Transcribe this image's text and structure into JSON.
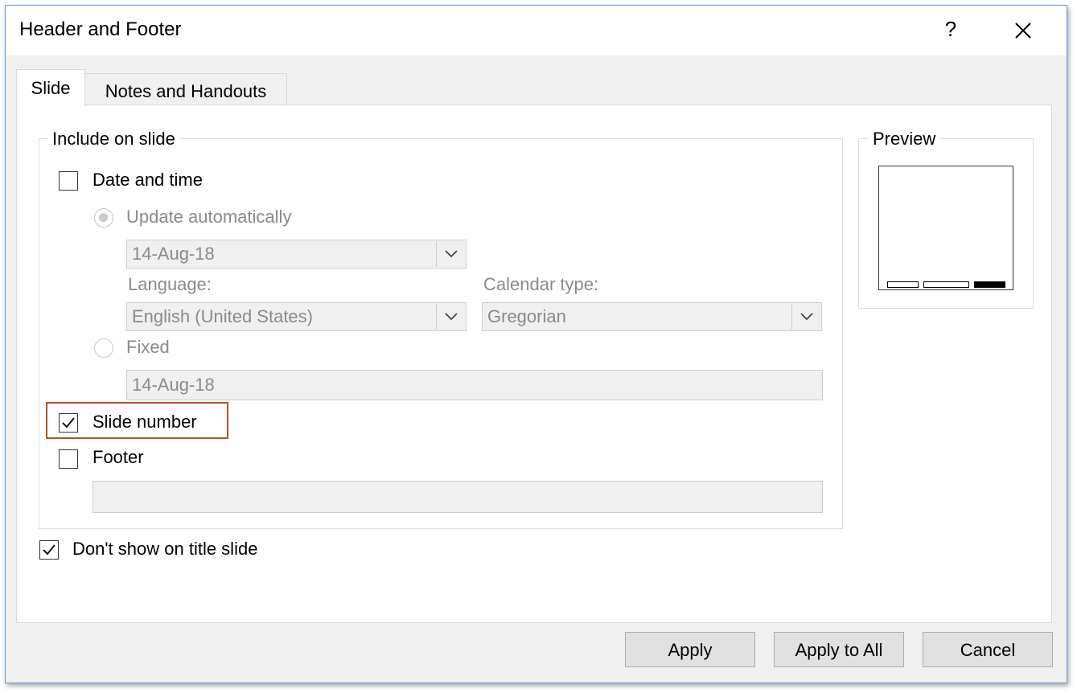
{
  "window": {
    "title": "Header and Footer",
    "help": "?"
  },
  "tabs": [
    {
      "label": "Slide",
      "active": true
    },
    {
      "label": "Notes and Handouts",
      "active": false
    }
  ],
  "include_group": {
    "legend": "Include on slide",
    "date_time": {
      "label": "Date and time",
      "checked": false
    },
    "update_automatically": {
      "label": "Update automatically",
      "selected": true,
      "enabled": false
    },
    "date_format": {
      "value": "14-Aug-18"
    },
    "language": {
      "label": "Language:",
      "value": "English (United States)"
    },
    "calendar_type": {
      "label": "Calendar type:",
      "value": "Gregorian"
    },
    "fixed": {
      "label": "Fixed",
      "selected": false,
      "enabled": false
    },
    "fixed_value": {
      "value": "14-Aug-18"
    },
    "slide_number": {
      "label": "Slide number",
      "checked": true
    },
    "footer": {
      "label": "Footer",
      "checked": false,
      "value": ""
    }
  },
  "dont_show_title": {
    "label": "Don't show on title slide",
    "checked": true
  },
  "preview": {
    "legend": "Preview",
    "indicators": [
      {
        "name": "date",
        "on": false
      },
      {
        "name": "footer",
        "on": false
      },
      {
        "name": "slide-number",
        "on": true
      }
    ]
  },
  "buttons": {
    "apply": "Apply",
    "apply_all": "Apply to All",
    "cancel": "Cancel"
  },
  "colors": {
    "highlight": "#b5502f",
    "window_border": "#5b9bd5"
  }
}
